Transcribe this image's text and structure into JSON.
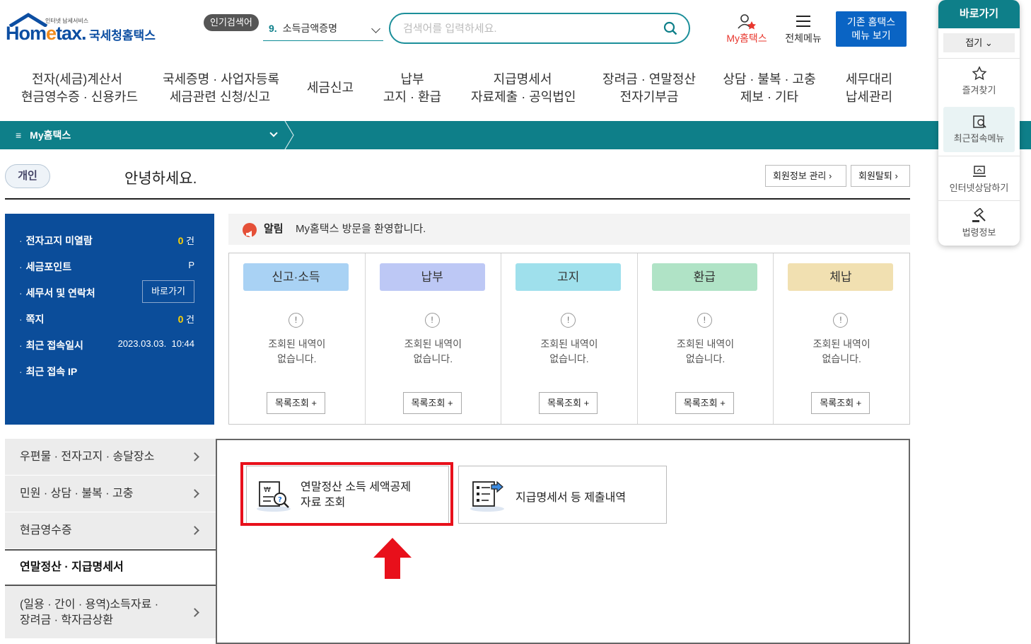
{
  "header": {
    "logo_small": "인터넷 납세서비스",
    "logo_brand_a": "Hom",
    "logo_brand_e": "e",
    "logo_brand_b": "tax.",
    "logo_kr": "국세청홈택스",
    "popular_badge": "인기검색어",
    "popular_rank": "9.",
    "popular_term": "소득금액증명",
    "search_placeholder": "검색어를 입력하세요.",
    "my_hometax": "My홈택스",
    "all_menu": "전체메뉴",
    "legacy_line1": "기존 홈택스",
    "legacy_line2": "메뉴 보기"
  },
  "nav": [
    {
      "l1": "전자(세금)계산서",
      "l2": "현금영수증 · 신용카드"
    },
    {
      "l1": "국세증명 · 사업자등록",
      "l2": "세금관련 신청/신고"
    },
    {
      "l1": "세금신고",
      "l2": ""
    },
    {
      "l1": "납부",
      "l2": "고지 · 환급"
    },
    {
      "l1": "지급명세서",
      "l2": "자료제출 · 공익법인"
    },
    {
      "l1": "장려금 · 연말정산",
      "l2": "전자기부금"
    },
    {
      "l1": "상담 · 불복 · 고충",
      "l2": "제보 · 기타"
    },
    {
      "l1": "세무대리",
      "l2": "납세관리"
    }
  ],
  "breadcrumb": {
    "menu_glyph": "≡",
    "label": "My홈택스"
  },
  "greeting": {
    "user_type": "개인",
    "text": "안녕하세요.",
    "member_info": "회원정보 관리 ›",
    "withdraw": "회원탈퇴 ›"
  },
  "info_panel": {
    "rows": [
      {
        "label": "전자고지 미열람",
        "num": "0",
        "unit": "건"
      },
      {
        "label": "세금포인트",
        "num": "",
        "unit": "P"
      },
      {
        "label": "세무서 및 연락처",
        "button": "바로가기"
      },
      {
        "label": "쪽지",
        "num": "0",
        "unit": "건"
      },
      {
        "label": "최근 접속일시",
        "value": "2023.03.03.  10:44"
      },
      {
        "label": "최근 접속 IP",
        "value": ""
      }
    ]
  },
  "alert": {
    "label": "알림",
    "message": "My홈택스 방문을 환영합니다."
  },
  "cards": [
    {
      "title": "신고·소득",
      "color": "#a9d2f4"
    },
    {
      "title": "납부",
      "color": "#bdc8f5"
    },
    {
      "title": "고지",
      "color": "#9fe0ec"
    },
    {
      "title": "환급",
      "color": "#b0e3c6"
    },
    {
      "title": "체납",
      "color": "#f1e0b1"
    }
  ],
  "card_common": {
    "excl": "!",
    "msg_line1": "조회된 내역이",
    "msg_line2": "없습니다.",
    "list_button": "목록조회 +"
  },
  "left_menu": [
    {
      "label": "우편물 · 전자고지 · 송달장소",
      "active": false
    },
    {
      "label": "민원 · 상담 · 불복 · 고충",
      "active": false
    },
    {
      "label": "현금영수증",
      "active": false
    },
    {
      "label": "연말정산 · 지급명세서",
      "active": true
    },
    {
      "label": "(일용 · 간이 · 용역)소득자료 ·",
      "label2": "장려금 · 학자금상환",
      "active": false
    }
  ],
  "content_buttons": [
    {
      "l1": "연말정산 소득 세액공제",
      "l2": "자료 조회"
    },
    {
      "l1": "지급명세서 등 제출내역",
      "l2": ""
    }
  ],
  "side_widget": {
    "title": "바로가기",
    "fold": "접기 ⌄",
    "items": [
      "즐겨찾기",
      "최근접속메뉴",
      "인터넷상담하기",
      "법령정보"
    ]
  },
  "colors": {
    "teal": "#0e7f89",
    "navy": "#0b4d9a",
    "highlight": "#e8101b",
    "brand_blue": "#0c4ea2"
  }
}
